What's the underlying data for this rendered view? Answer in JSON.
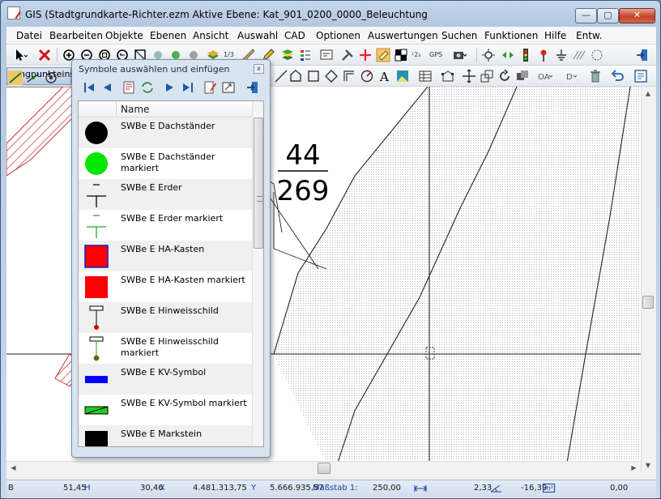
{
  "window": {
    "title": "GIS (Stadtgrundkarte-Richter.ezm Aktive Ebene: Kat_901_0200_0000_Beleuchtung",
    "minimize_label": "—",
    "maximize_label": "▢",
    "close_label": "✕"
  },
  "menu": {
    "items": [
      "Datei",
      "Bearbeiten",
      "Objekte",
      "Ebenen",
      "Ansicht",
      "Auswahl",
      "CAD",
      "Optionen",
      "Auswertungen",
      "Suchen",
      "Funktionen",
      "Hilfe",
      "Entw."
    ]
  },
  "toolbar": {
    "scale_label": "1/3",
    "xyz_label": "¹2₃",
    "gps_label": "GPS",
    "fangpunkt_label": "Fangpunkteins"
  },
  "map": {
    "parcel_number_top": "44",
    "parcel_number_bottom": "269"
  },
  "dialog": {
    "title": "Symbole auswählen und einfügen",
    "close_label": "x",
    "column_name": "Name",
    "items": [
      {
        "label": "SWBe E Dachständer",
        "symbol": "black-circle-icon"
      },
      {
        "label": "SWBe E Dachständer markiert",
        "symbol": "green-circle-icon"
      },
      {
        "label": "SWBe E Erder",
        "symbol": "ground-electrode-icon"
      },
      {
        "label": "SWBe E Erder markiert",
        "symbol": "ground-electrode-green-icon"
      },
      {
        "label": "SWBe E HA-Kasten",
        "symbol": "red-square-blue-border-icon"
      },
      {
        "label": "SWBe E HA-Kasten markiert",
        "symbol": "red-square-icon"
      },
      {
        "label": "SWBe E Hinweisschild",
        "symbol": "sign-post-icon"
      },
      {
        "label": "SWBe E Hinweisschild markiert",
        "symbol": "sign-post-green-icon"
      },
      {
        "label": "SWBe E KV-Symbol",
        "symbol": "blue-bar-icon"
      },
      {
        "label": "SWBe E KV-Symbol markiert",
        "symbol": "green-bar-icon"
      },
      {
        "label": "SWBe E Markstein",
        "symbol": "black-rect-icon"
      }
    ]
  },
  "status": {
    "mode": "B",
    "h_value": "51,45",
    "h_unit": "H",
    "x_value": "30,46",
    "x_unit": "X",
    "rechts_value": "4.481.313,75",
    "rechts_unit": "Y",
    "hoch_value": "5.666.935,57",
    "massstab_label": "Maßstab 1:",
    "massstab_value": "250,00",
    "dist_value": "2,33",
    "angle_value": "-16,39",
    "area_unit": "m²",
    "last_value": "0,00"
  },
  "colors": {
    "hatch_red": "#c8323c",
    "map_dots": "#b5b5b5",
    "accent": "#1a3f9a"
  }
}
